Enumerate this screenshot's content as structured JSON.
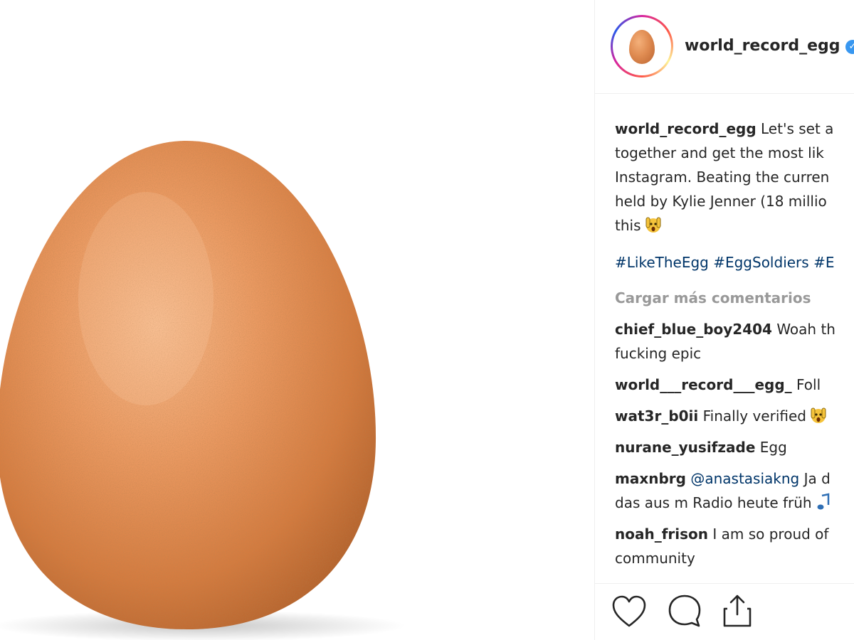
{
  "post": {
    "author": "world_record_egg",
    "verified": true,
    "caption_lines": [
      "Let's set a",
      "together and get the most lik",
      "Instagram. Beating the curren",
      "held by Kylie Jenner (18 millio",
      "this"
    ],
    "hashtags": [
      "#LikeTheEgg",
      "#EggSoldiers",
      "#E"
    ],
    "load_more_label": "Cargar más comentarios"
  },
  "comments": [
    {
      "user": "chief_blue_boy2404",
      "lines": [
        "Woah th",
        "fucking epic"
      ]
    },
    {
      "user": "world___record___egg_",
      "lines": [
        "Foll"
      ]
    },
    {
      "user": "wat3r_b0ii",
      "lines": [
        "Finally verified"
      ],
      "emoji": "scream-face"
    },
    {
      "user": "nurane_yusifzade",
      "lines": [
        "Egg"
      ]
    },
    {
      "user": "maxnbrg",
      "mention": "@anastasiakng",
      "lines": [
        "Ja d",
        "das aus m Radio heute früh"
      ],
      "emoji": "music-note"
    },
    {
      "user": "noah_frison",
      "lines": [
        "I am so proud of",
        "community"
      ]
    }
  ],
  "actions": {
    "like_icon": "heart-icon",
    "comment_icon": "comment-bubble-icon",
    "share_icon": "share-icon"
  },
  "colors": {
    "username": "#262626",
    "hashtag": "#003569",
    "muted": "#999999",
    "verified": "#3897f0",
    "egg": "#e08c52"
  }
}
